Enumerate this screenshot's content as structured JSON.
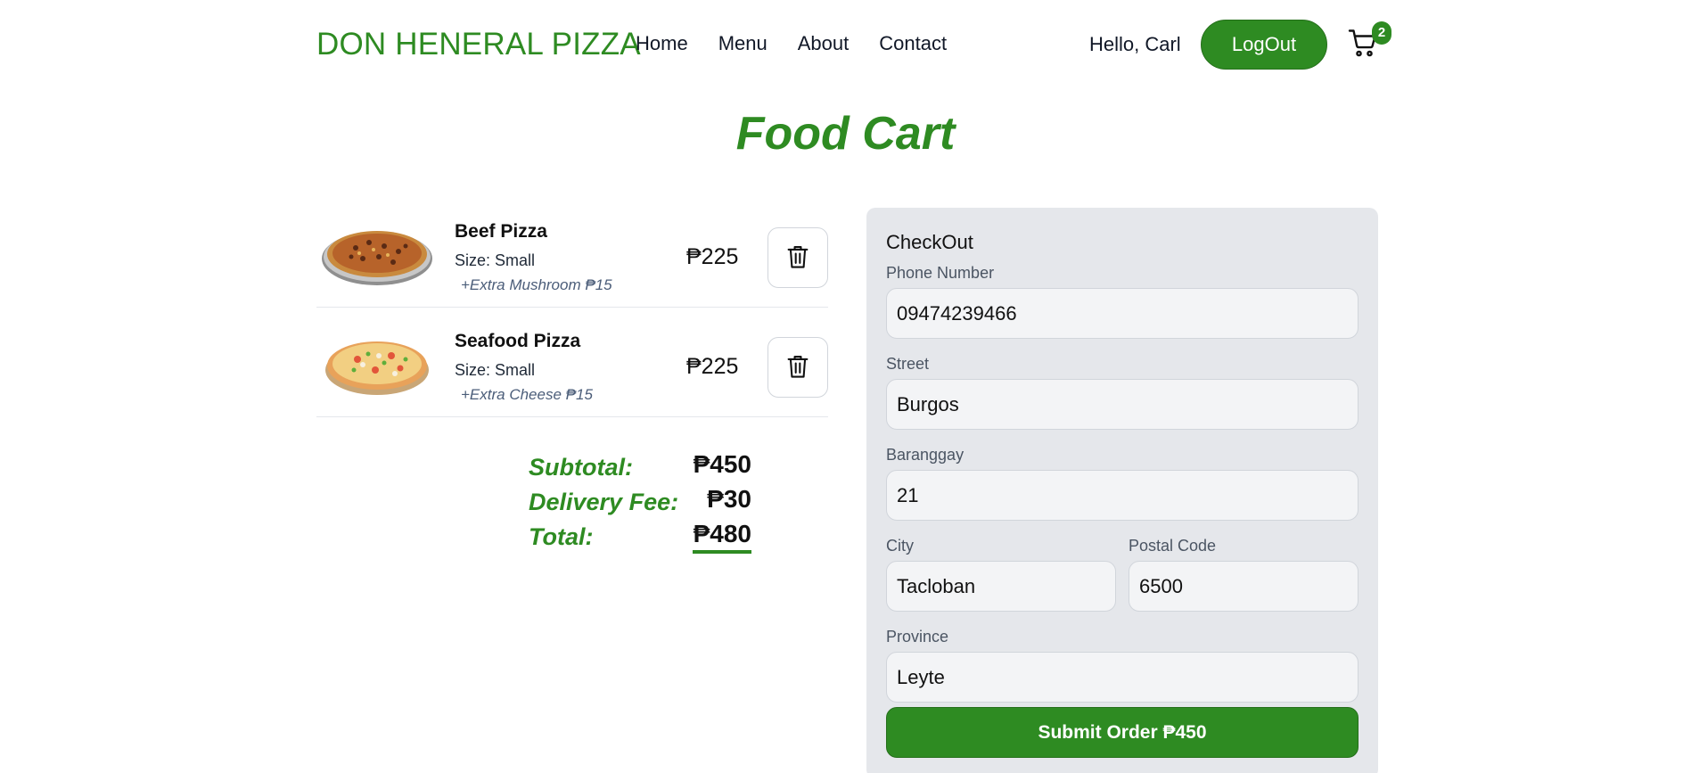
{
  "header": {
    "brand": "DON HENERAL PIZZA",
    "nav": [
      "Home",
      "Menu",
      "About",
      "Contact"
    ],
    "greeting": "Hello, Carl",
    "logout_label": "LogOut",
    "cart_icon": "shopping-cart-icon",
    "cart_count": "2"
  },
  "page_title": "Food Cart",
  "cart": {
    "items": [
      {
        "name": "Beef Pizza",
        "size": "Size: Small",
        "extra": "+Extra Mushroom ₱15",
        "price": "₱225",
        "delete_icon": "trash-icon"
      },
      {
        "name": "Seafood Pizza",
        "size": "Size: Small",
        "extra": "+Extra Cheese ₱15",
        "price": "₱225",
        "delete_icon": "trash-icon"
      }
    ],
    "totals": {
      "subtotal_label": "Subtotal:",
      "subtotal": "₱450",
      "delivery_label": "Delivery Fee:",
      "delivery": "₱30",
      "total_label": "Total:",
      "total": "₱480"
    }
  },
  "checkout": {
    "title": "CheckOut",
    "phone": {
      "label": "Phone Number",
      "value": "09474239466"
    },
    "street": {
      "label": "Street",
      "value": "Burgos"
    },
    "barangay": {
      "label": "Baranggay",
      "value": "21"
    },
    "city": {
      "label": "City",
      "value": "Tacloban"
    },
    "postal": {
      "label": "Postal Code",
      "value": "6500"
    },
    "province": {
      "label": "Province",
      "value": "Leyte"
    },
    "submit_label": "Submit Order ₱450"
  },
  "colors": {
    "accent": "#2e8b22",
    "panel": "#e5e7eb"
  }
}
